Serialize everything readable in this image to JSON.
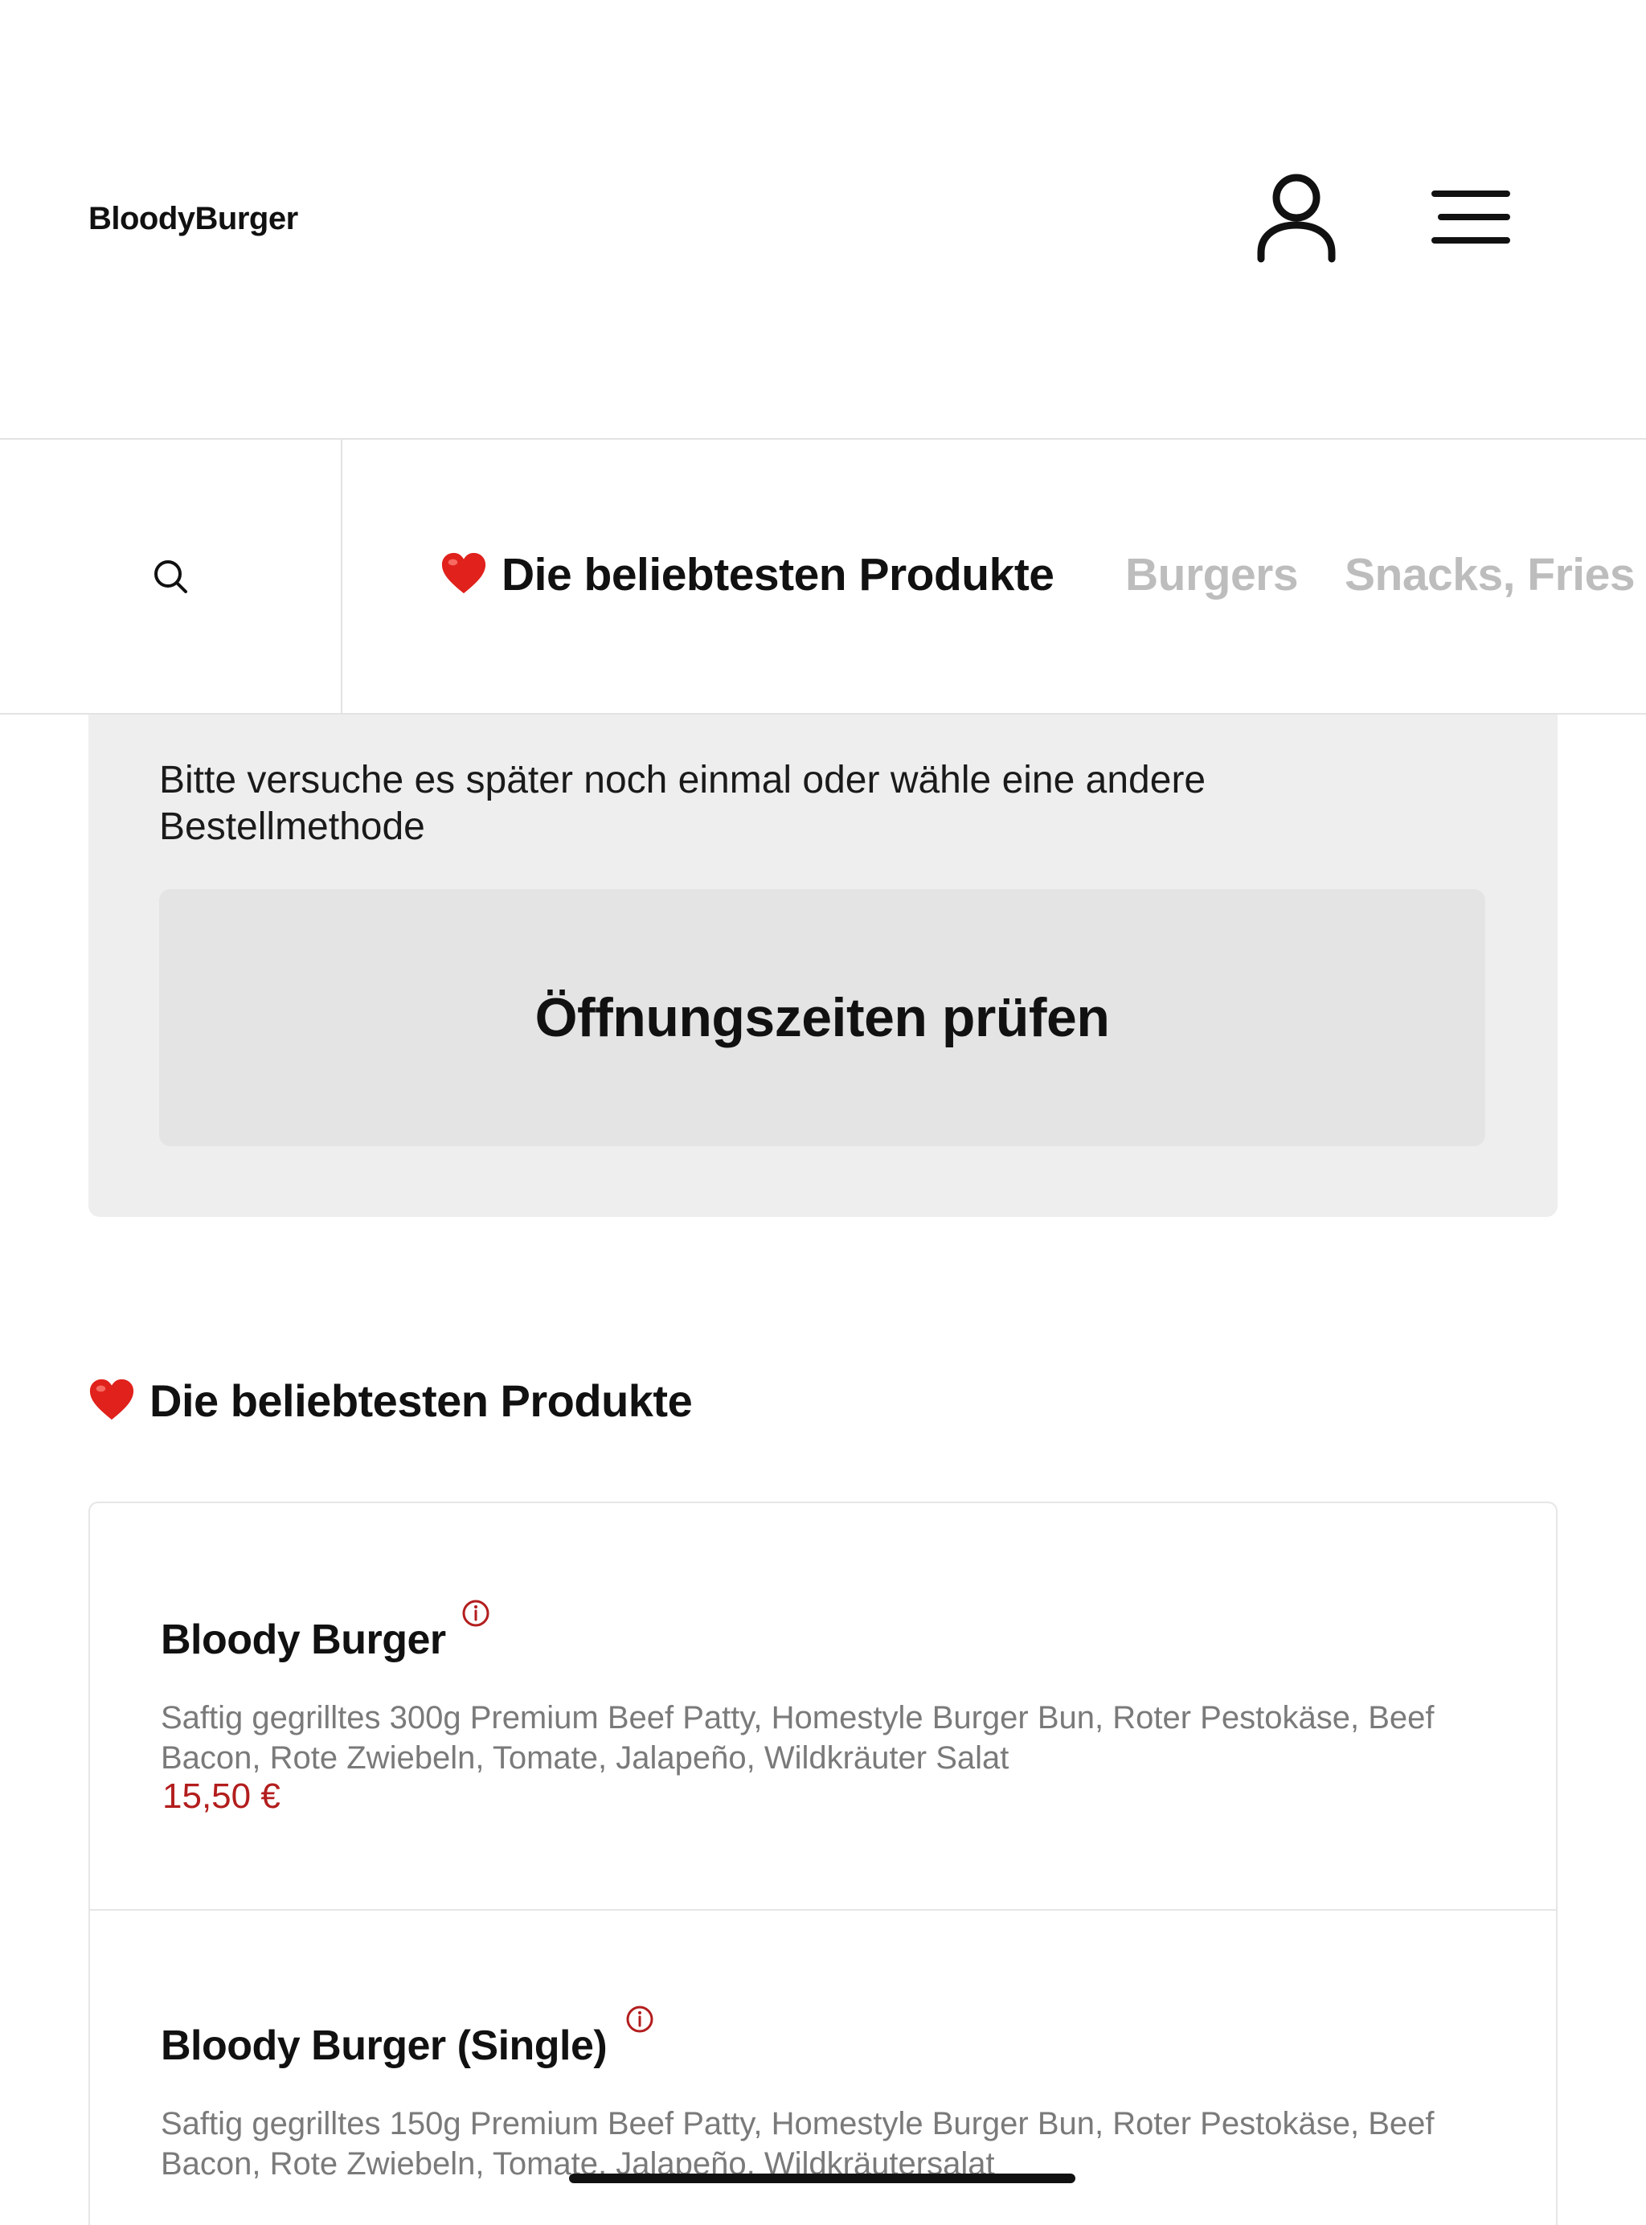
{
  "header": {
    "brand": "BloodyBurger",
    "account_icon": "user-icon",
    "menu_icon": "hamburger-menu-icon"
  },
  "category_bar": {
    "search_icon": "search-icon",
    "items": [
      {
        "label": "Die beliebtesten Produkte",
        "emoji": "❤️",
        "active": true
      },
      {
        "label": "Burgers",
        "active": false
      },
      {
        "label": "Snacks, Fries",
        "active": false
      }
    ]
  },
  "notice": {
    "message": "Bitte versuche es später noch einmal oder wähle eine andere Bestellmethode",
    "button_label": "Öffnungszeiten prüfen"
  },
  "section": {
    "emoji": "❤️",
    "title": "Die beliebtesten Produkte"
  },
  "products": [
    {
      "name": "Bloody Burger",
      "description": "Saftig gegrilltes 300g Premium Beef Patty, Homestyle Burger Bun, Roter Pestokäse, Beef Bacon, Rote Zwiebeln, Tomate, Jalapeño, Wildkräuter Salat",
      "price": "15,50 €"
    },
    {
      "name": "Bloody Burger (Single)",
      "description": "Saftig gegrilltes 150g Premium Beef Patty, Homestyle Burger Bun, Roter Pestokäse, Beef Bacon, Rote Zwiebeln, Tomate, Jalapeño, Wildkräutersalat",
      "price": ""
    }
  ],
  "colors": {
    "accent": "#b31d1d",
    "heart": "#e0211c",
    "inactive_tab": "#bdbdbd",
    "card_bg": "#eeeeee",
    "button_bg": "#e4e4e4"
  }
}
